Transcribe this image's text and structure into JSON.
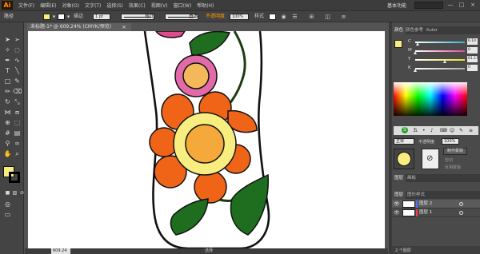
{
  "app": {
    "logo": "Ai",
    "workspace": "基本功能",
    "window_controls": [
      "—",
      "□",
      "×"
    ]
  },
  "menus": [
    "文件(F)",
    "编辑(E)",
    "对象(O)",
    "文字(T)",
    "选择(S)",
    "效果(C)",
    "视图(V)",
    "窗口(W)",
    "帮助(H)"
  ],
  "control_bar": {
    "selection_label": "路径",
    "stroke_label": "描边",
    "stroke_weight": "1 pt",
    "profile_label": "等比",
    "brush_label": "基本",
    "opacity_label": "不透明度",
    "opacity_value": "100%",
    "style_label": "样式",
    "fill_color": "#f8ee80",
    "stroke_color": "#111111"
  },
  "document": {
    "tab_title": "未标题-1* @ 609.24% (CMYK/预览)",
    "close": "×",
    "zoom": "609.24",
    "status": "选择"
  },
  "color_panel": {
    "tabs": [
      "颜色",
      "颜色参考",
      "Kuler"
    ],
    "sliders": [
      {
        "label": "C",
        "value": "6.14",
        "level": 0.06,
        "color": "#2fb5d9"
      },
      {
        "label": "M",
        "value": "0",
        "level": 0.0,
        "color": "#e64a96"
      },
      {
        "label": "Y",
        "value": "61.17",
        "level": 0.61,
        "color": "#e8df2a"
      },
      {
        "label": "K",
        "value": "0",
        "level": 0.0,
        "color": "#aaaaaa"
      }
    ]
  },
  "cc_bar": {
    "items": [
      "五",
      "•",
      "♪",
      "⌨",
      "☺",
      "✎",
      "≡"
    ]
  },
  "appearance_panel": {
    "blend_mode": "正常",
    "opacity_label": "不透明度",
    "opacity_value": "100%",
    "make_mask": "制作蒙版",
    "clip": "剪切",
    "invert": "反相蒙版"
  },
  "layers_panel": {
    "tabs": [
      "图层",
      "画板"
    ],
    "second_tabs": [
      "图层",
      "图形样式"
    ],
    "rows": [
      {
        "name": "图层 2",
        "color": "#4a74ff",
        "selected": true
      },
      {
        "name": "图层 1",
        "color": "#ff3b3b",
        "selected": false
      }
    ],
    "footer": "2 个图层"
  },
  "artwork": {
    "petal_color": "#f06418",
    "center_color": "#f8ee80",
    "center_inner": "#f5a93a",
    "leaf_color": "#1f6e20",
    "small_flower_ring": "#e36aa8",
    "small_flower_center": "#f3b85a",
    "stem_color": "#1f3a10"
  }
}
